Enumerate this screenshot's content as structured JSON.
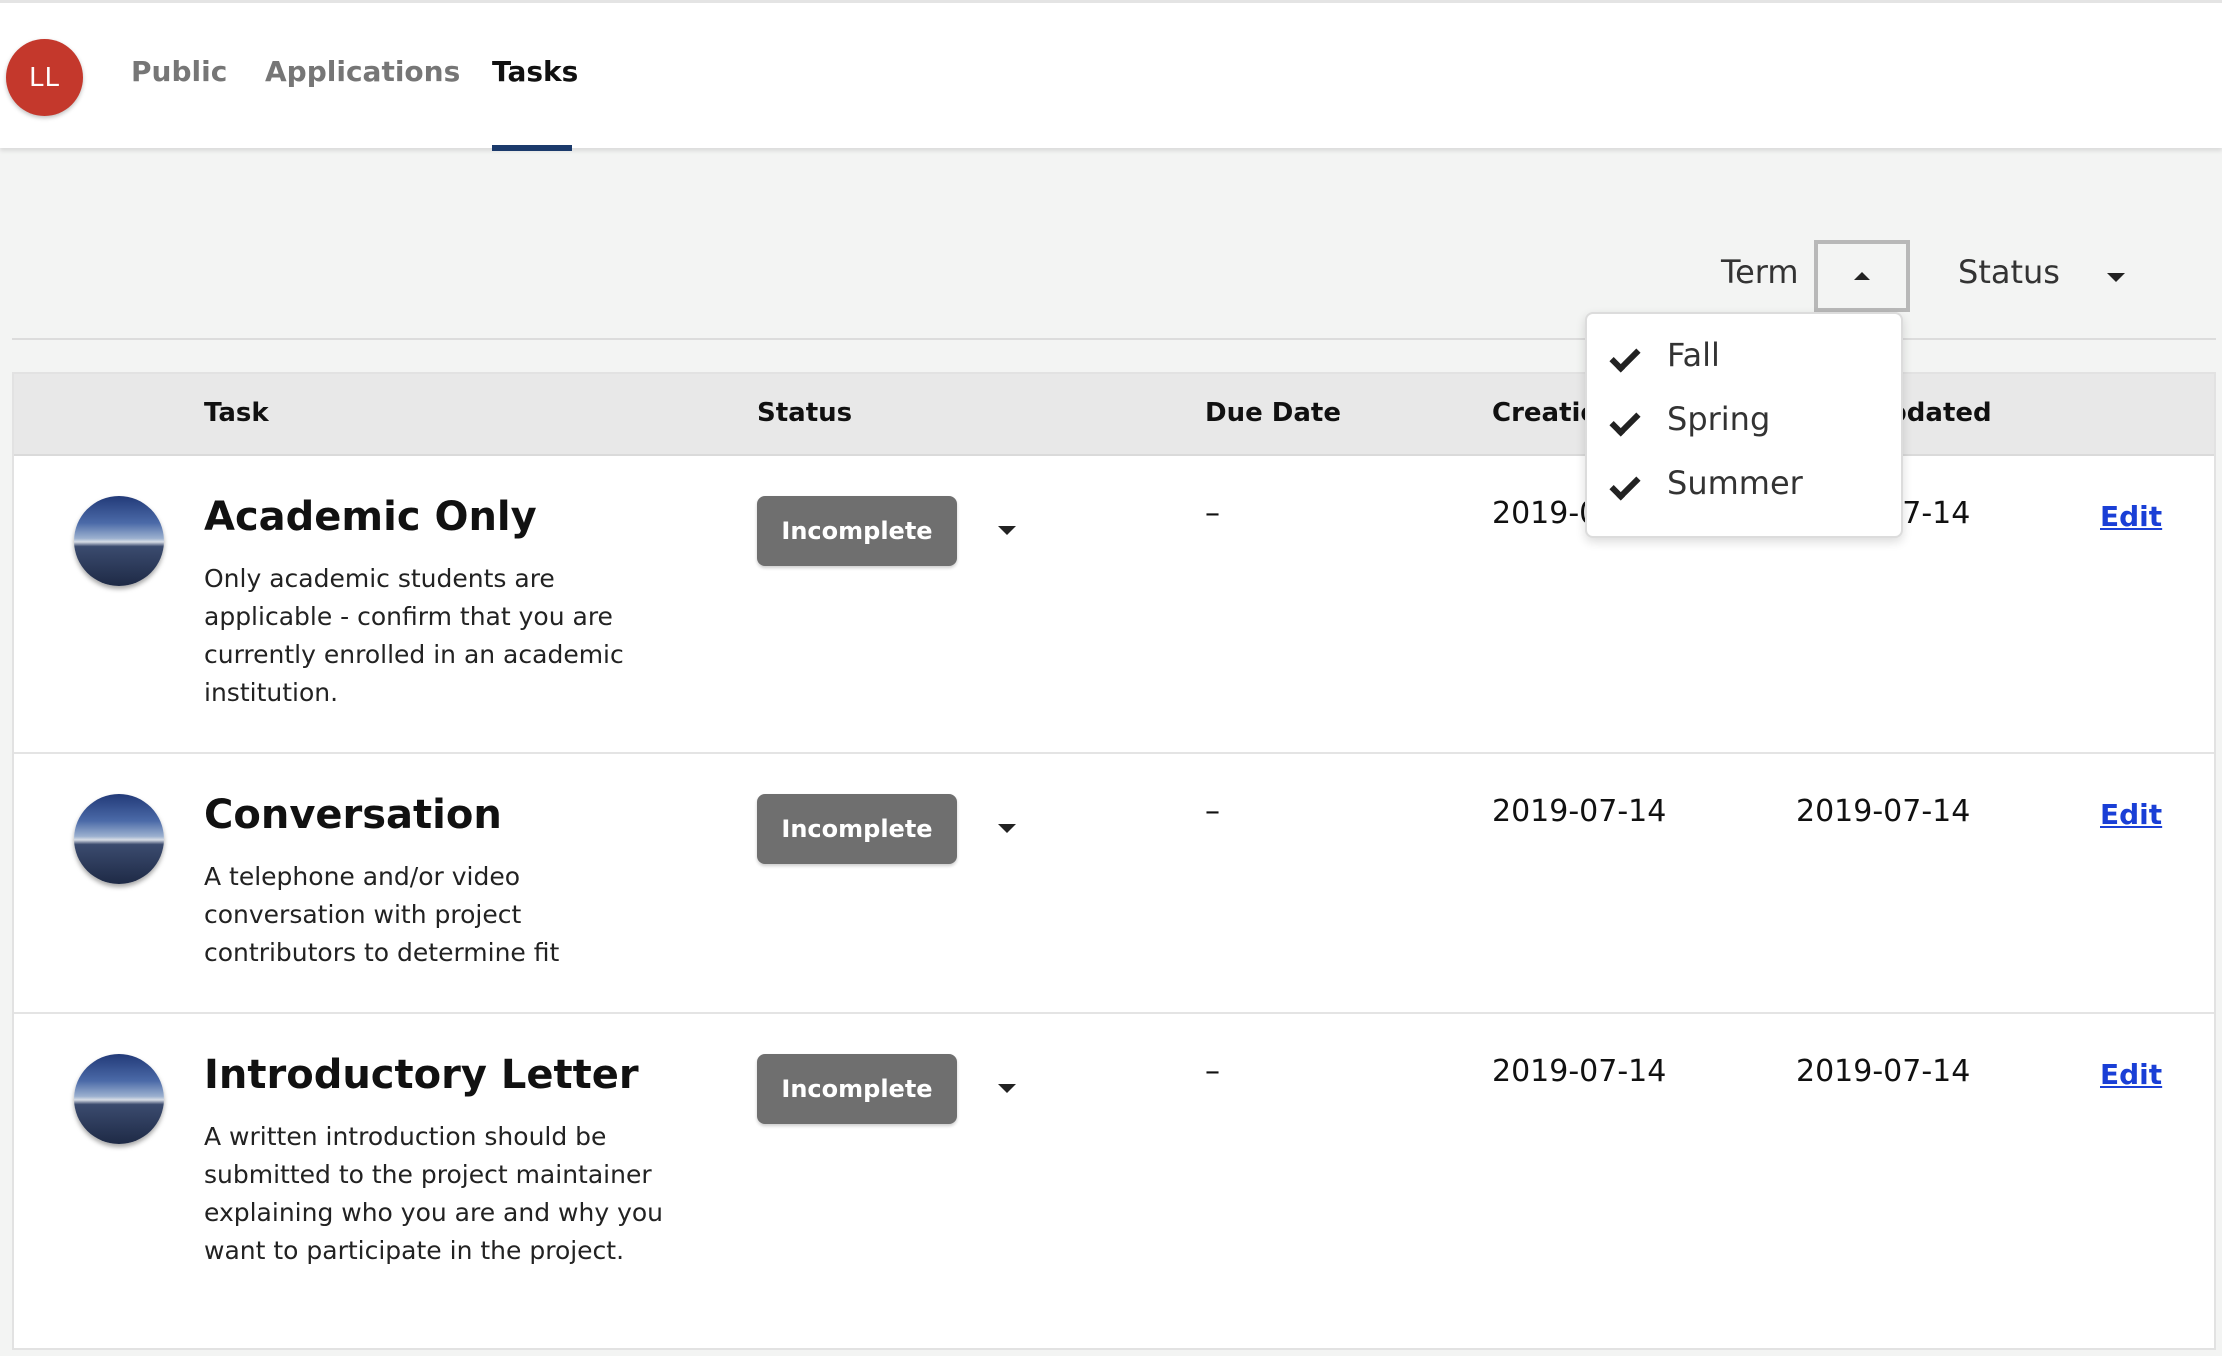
{
  "nav": {
    "avatar_initials": "LL",
    "tabs": [
      {
        "label": "Public"
      },
      {
        "label": "Applications"
      },
      {
        "label": "Tasks"
      }
    ],
    "active_tab": "Tasks"
  },
  "filters": {
    "term_label": "Term",
    "status_label": "Status",
    "term_menu_open": true,
    "term_options": [
      {
        "label": "Fall",
        "checked": true
      },
      {
        "label": "Spring",
        "checked": true
      },
      {
        "label": "Summer",
        "checked": true
      }
    ]
  },
  "table": {
    "columns": [
      "Task",
      "Status",
      "Due Date",
      "Creation Date",
      "Last Updated"
    ],
    "rows": [
      {
        "title": "Academic Only",
        "description": "Only academic students are applicable - confirm that you are currently enrolled in an academic institution.",
        "status": "Incomplete",
        "due_date": "–",
        "created": "2019-07-14",
        "updated": "2019-07-14",
        "action": "Edit"
      },
      {
        "title": "Conversation",
        "description": "A telephone and/or video conversation with project contributors to determine fit",
        "status": "Incomplete",
        "due_date": "–",
        "created": "2019-07-14",
        "updated": "2019-07-14",
        "action": "Edit"
      },
      {
        "title": "Introductory Letter",
        "description": "A written introduction should be submitted to the project maintainer explaining who you are and why you want to participate in the project.",
        "status": "Incomplete",
        "due_date": "–",
        "created": "2019-07-14",
        "updated": "2019-07-14",
        "action": "Edit"
      }
    ]
  },
  "colors": {
    "avatar": "#c4382c",
    "active_tab_underline": "#1b3a6b",
    "status_button": "#6f6f6f",
    "link": "#1a3fd6"
  },
  "icons": {
    "menu_check": "check-icon",
    "term_toggle": "caret-up-icon",
    "status_toggle": "caret-down-icon"
  }
}
